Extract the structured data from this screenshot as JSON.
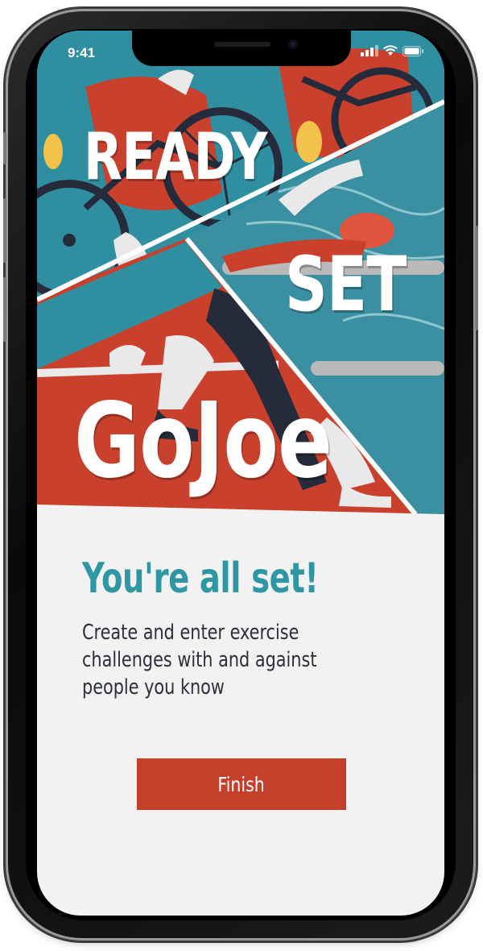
{
  "status_bar": {
    "time": "9:41",
    "icons": [
      "signal-icon",
      "wifi-icon",
      "battery-icon"
    ]
  },
  "hero": {
    "words": [
      "READY",
      "SET",
      "GoJoe"
    ]
  },
  "content": {
    "headline": "You're all set!",
    "description": "Create and enter exercise challenges with and against people you know"
  },
  "actions": {
    "finish_label": "Finish"
  },
  "colors": {
    "accent_teal": "#2f97a3",
    "brand_red": "#c5402b",
    "dark_navy": "#252b3a",
    "background": "#f2f2f2"
  }
}
